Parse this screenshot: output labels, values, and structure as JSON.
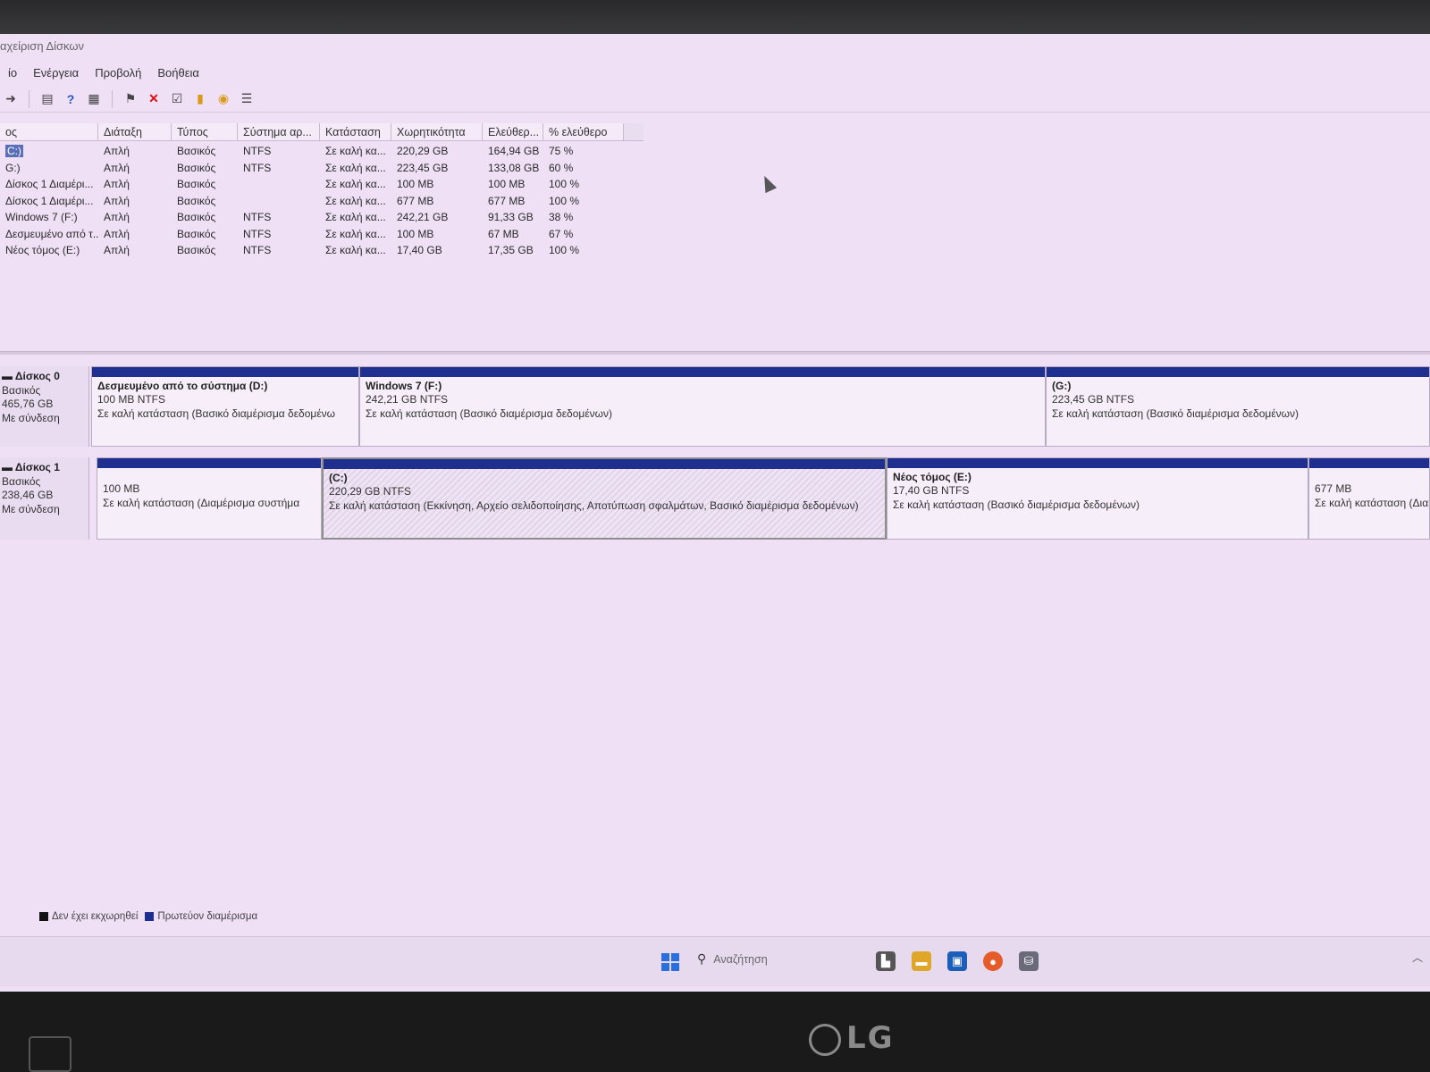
{
  "window": {
    "title": "αχείριση Δίσκων"
  },
  "menu": [
    "ίο",
    "Ενέργεια",
    "Προβολή",
    "Βοήθεια"
  ],
  "toolbar": [
    "back-icon",
    "console-icon",
    "help-icon",
    "properties-icon",
    "connect-icon",
    "delete-icon",
    "check-icon",
    "folder-up-icon",
    "folder-search-icon",
    "list-icon"
  ],
  "volume_table": {
    "headers": [
      "ος",
      "Διάταξη",
      "Τύπος",
      "Σύστημα αρ...",
      "Κατάσταση",
      "Χωρητικότητα",
      "Ελεύθερ...",
      "% ελεύθερο"
    ],
    "rows": [
      {
        "name": "C:)",
        "layout": "Απλή",
        "type": "Βασικός",
        "fs": "NTFS",
        "status": "Σε καλή κα...",
        "capacity": "220,29 GB",
        "free": "164,94 GB",
        "pct": "75 %",
        "selected": true
      },
      {
        "name": "G:)",
        "layout": "Απλή",
        "type": "Βασικός",
        "fs": "NTFS",
        "status": "Σε καλή κα...",
        "capacity": "223,45 GB",
        "free": "133,08 GB",
        "pct": "60 %"
      },
      {
        "name": "Δίσκος 1 Διαμέρι...",
        "layout": "Απλή",
        "type": "Βασικός",
        "fs": "",
        "status": "Σε καλή κα...",
        "capacity": "100 MB",
        "free": "100 MB",
        "pct": "100 %"
      },
      {
        "name": "Δίσκος 1 Διαμέρι...",
        "layout": "Απλή",
        "type": "Βασικός",
        "fs": "",
        "status": "Σε καλή κα...",
        "capacity": "677 MB",
        "free": "677 MB",
        "pct": "100 %"
      },
      {
        "name": "Windows 7 (F:)",
        "layout": "Απλή",
        "type": "Βασικός",
        "fs": "NTFS",
        "status": "Σε καλή κα...",
        "capacity": "242,21 GB",
        "free": "91,33 GB",
        "pct": "38 %"
      },
      {
        "name": "Δεσμευμένο από τ...",
        "layout": "Απλή",
        "type": "Βασικός",
        "fs": "NTFS",
        "status": "Σε καλή κα...",
        "capacity": "100 MB",
        "free": "67 MB",
        "pct": "67 %"
      },
      {
        "name": "Νέος τόμος (E:)",
        "layout": "Απλή",
        "type": "Βασικός",
        "fs": "NTFS",
        "status": "Σε καλή κα...",
        "capacity": "17,40 GB",
        "free": "17,35 GB",
        "pct": "100 %"
      }
    ]
  },
  "disks": [
    {
      "name": "Δίσκος 0",
      "type": "Βασικός",
      "size": "465,76 GB",
      "state": "Με σύνδεση",
      "partitions": [
        {
          "name": "Δεσμευμένο από το σύστημα (D:)",
          "size": "100 MB NTFS",
          "status": "Σε καλή κατάσταση (Βασικό διαμέρισμα δεδομένω"
        },
        {
          "name": "Windows 7 (F:)",
          "size": "242,21 GB NTFS",
          "status": "Σε καλή κατάσταση (Βασικό διαμέρισμα δεδομένων)"
        },
        {
          "name": "(G:)",
          "size": "223,45 GB NTFS",
          "status": "Σε καλή κατάσταση (Βασικό διαμέρισμα δεδομένων)"
        }
      ]
    },
    {
      "name": "Δίσκος 1",
      "type": "Βασικός",
      "size": "238,46 GB",
      "state": "Με σύνδεση",
      "partitions": [
        {
          "name": "",
          "size": "100 MB",
          "status": "Σε καλή κατάσταση (Διαμέρισμα συστήμα"
        },
        {
          "name": "(C:)",
          "size": "220,29 GB NTFS",
          "status": "Σε καλή κατάσταση (Εκκίνηση, Αρχείο σελιδοποίησης, Αποτύπωση σφαλμάτων, Βασικό διαμέρισμα δεδομένων)"
        },
        {
          "name": "Νέος τόμος (E:)",
          "size": "17,40 GB NTFS",
          "status": "Σε καλή κατάσταση (Βασικό διαμέρισμα δεδομένων)"
        },
        {
          "name": "",
          "size": "677 MB",
          "status": "Σε καλή κατάσταση (Διαμέ"
        }
      ]
    }
  ],
  "legend": [
    {
      "label": "Δεν έχει εκχωρηθεί",
      "color": "#111111"
    },
    {
      "label": "Πρωτεύον διαμέρισμα",
      "color": "#1f2f8f"
    }
  ],
  "taskbar": {
    "search_placeholder": "Αναζήτηση",
    "apps": [
      "start-icon",
      "file-explorer-icon",
      "folder-icon",
      "store-icon",
      "firefox-icon",
      "disk-management-icon"
    ]
  },
  "monitor": {
    "brand": "LG"
  }
}
